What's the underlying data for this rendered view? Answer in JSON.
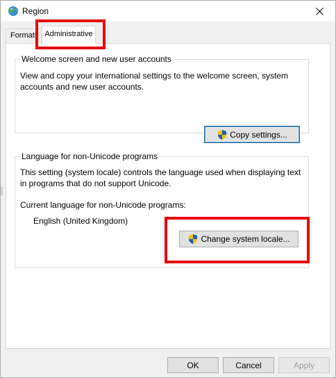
{
  "window": {
    "title": "Region",
    "icon": "globe-icon",
    "close_label": "✕"
  },
  "tabs": [
    {
      "label": "Formats",
      "active": false
    },
    {
      "label": "Administrative",
      "active": true
    }
  ],
  "welcome_group": {
    "label": "Welcome screen and new user accounts",
    "description": "View and copy your international settings to the welcome screen, system accounts and new user accounts.",
    "button_label": "Copy settings...",
    "button_icon": "uac-shield-icon"
  },
  "unicode_group": {
    "label": "Language for non-Unicode programs",
    "description": "This setting (system locale) controls the language used when displaying text in programs that do not support Unicode.",
    "current_label": "Current language for non-Unicode programs:",
    "current_value": "English (United Kingdom)",
    "button_label": "Change system locale...",
    "button_icon": "uac-shield-icon"
  },
  "footer": {
    "ok_label": "OK",
    "cancel_label": "Cancel",
    "apply_label": "Apply",
    "apply_enabled": false
  },
  "colors": {
    "highlight": "#e8000b",
    "default_button_border": "#3c7fb1",
    "panel_background": "#ffffff",
    "dialog_background": "#f0f0f0"
  }
}
